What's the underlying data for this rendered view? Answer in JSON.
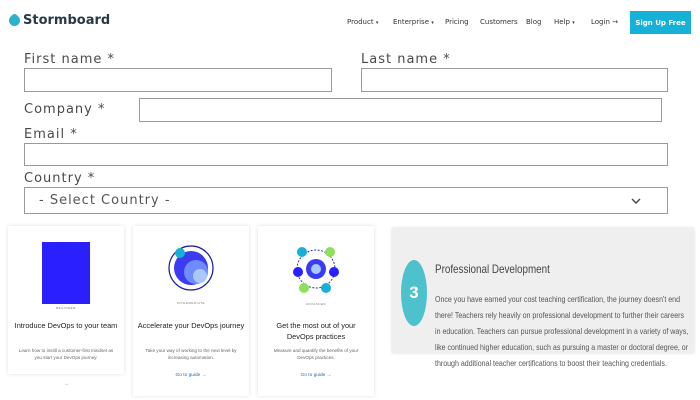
{
  "nav": {
    "brand": "Stormboard",
    "items": [
      {
        "label": "Product",
        "caret": "▾"
      },
      {
        "label": "Enterprise",
        "caret": "▾"
      },
      {
        "label": "Pricing",
        "caret": ""
      },
      {
        "label": "Customers",
        "caret": ""
      },
      {
        "label": "Blog",
        "caret": ""
      },
      {
        "label": "Help",
        "caret": "▾"
      },
      {
        "label": "Login →",
        "caret": ""
      }
    ],
    "cta": "Sign Up Free"
  },
  "form": {
    "first_name_label": "First name *",
    "last_name_label": "Last name *",
    "company_label": "Company *",
    "email_label": "Email *",
    "country_label": "Country *",
    "country_placeholder": "- Select Country -"
  },
  "cards": [
    {
      "kicker": "BEGINNER",
      "title": "Introduce DevOps to your team",
      "desc": "Learn how to instill a customer-first mindset as you start your DevOps journey.",
      "link": "→"
    },
    {
      "kicker": "INTERMEDIATE",
      "title": "Accelerate your DevOps journey",
      "desc": "Take your way of working to the next level by increasing automation.",
      "link": "Go to guide →"
    },
    {
      "kicker": "ADVANCED",
      "title": "Get the most out of your DevOps practices",
      "desc": "Measure and quantify the benefits of your DevOps practices.",
      "link": "Go to guide →"
    }
  ],
  "pd": {
    "number": "3",
    "title": "Professional Development",
    "body": "Once you have earned your cost teaching certification, the journey doesn't end there! Teachers rely heavily on professional development to further their careers in education. Teachers can pursue professional development in a variety of ways, like continued higher education, such as pursuing a master or doctoral degree, or through additional teacher certifications to boost their teaching credentials."
  },
  "colors": {
    "accent": "#16b1d6",
    "pd_circle": "#4ec2cc",
    "card1_blue": "#2a1fff",
    "link": "#1a6db0"
  }
}
